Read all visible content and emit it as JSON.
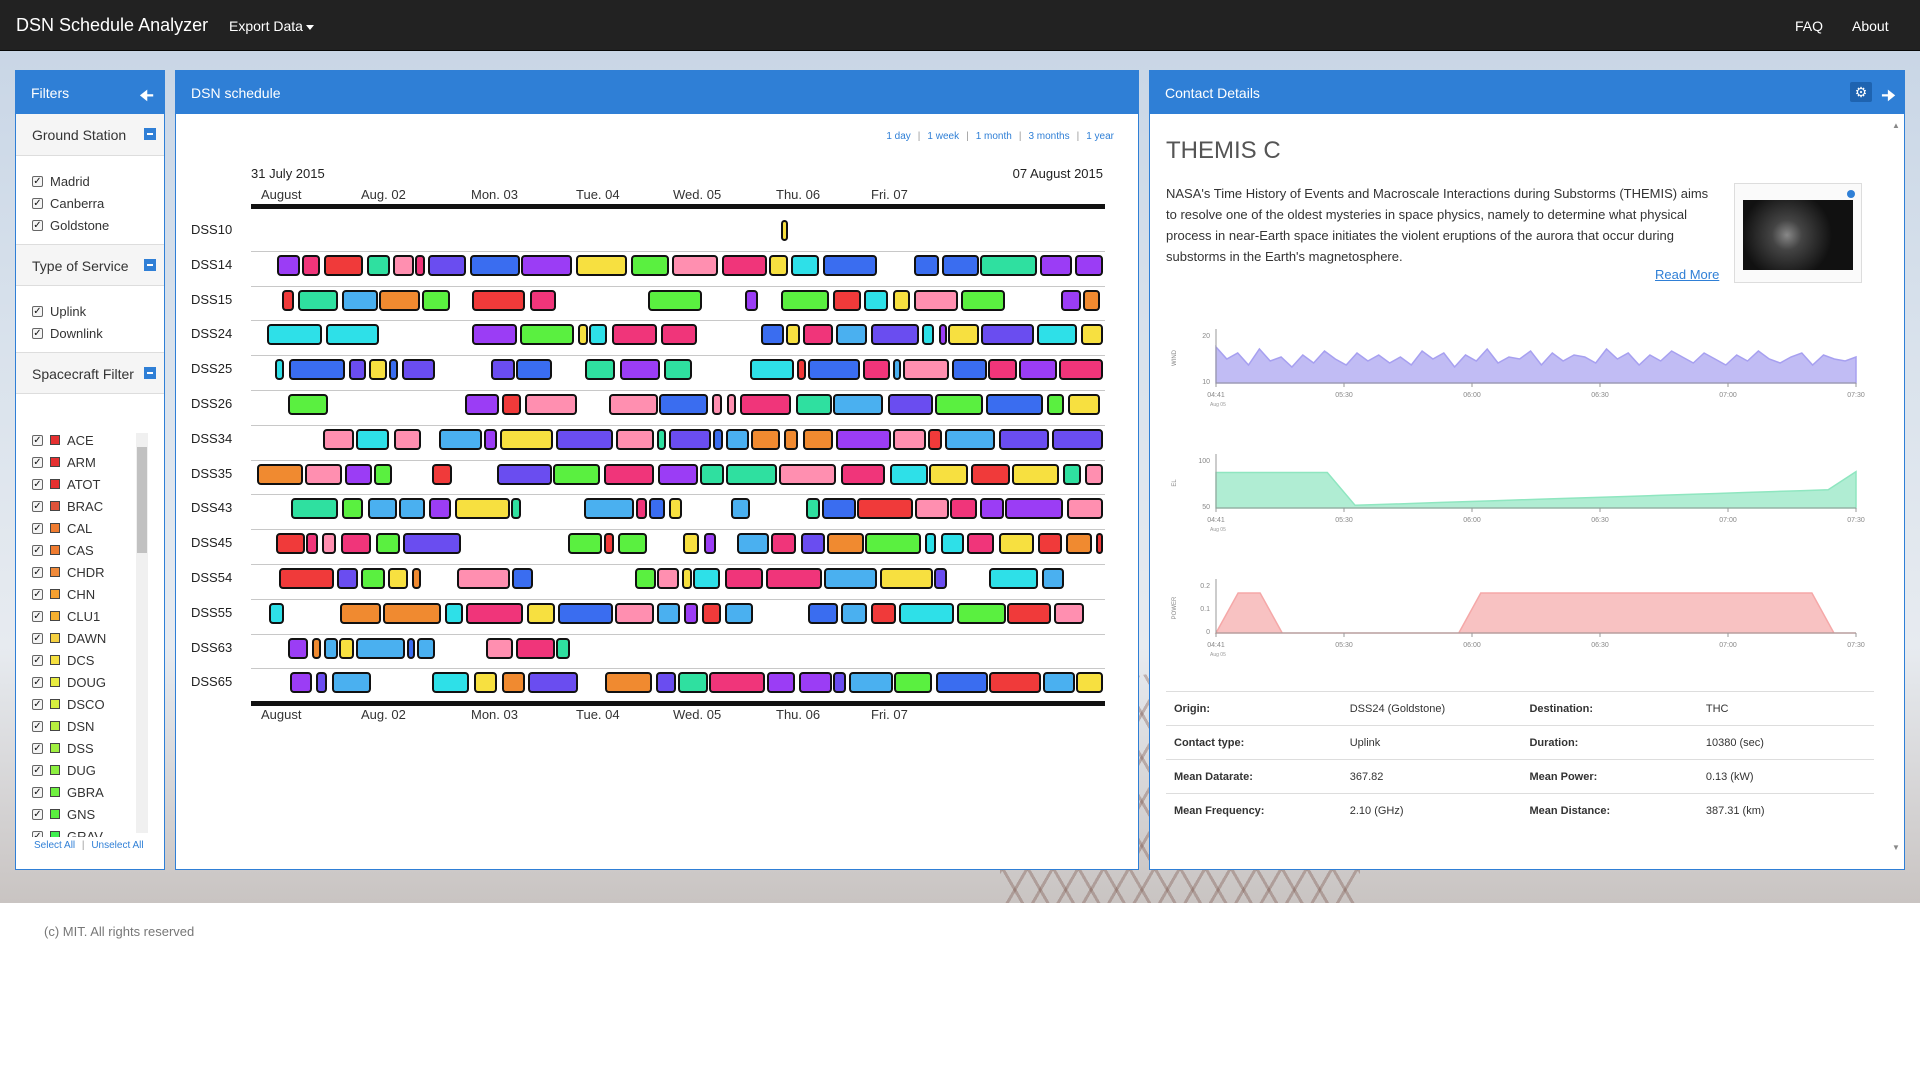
{
  "nav": {
    "brand": "DSN Schedule Analyzer",
    "export": "Export Data",
    "faq": "FAQ",
    "about": "About"
  },
  "filters": {
    "title": "Filters",
    "ground_station": {
      "title": "Ground Station",
      "items": [
        "Madrid",
        "Canberra",
        "Goldstone"
      ]
    },
    "service": {
      "title": "Type of Service",
      "items": [
        "Uplink",
        "Downlink"
      ]
    },
    "spacecraft": {
      "title": "Spacecraft Filter",
      "items": [
        {
          "name": "ACE",
          "color": "#e53030"
        },
        {
          "name": "ARM",
          "color": "#e53030"
        },
        {
          "name": "ATOT",
          "color": "#e53030"
        },
        {
          "name": "BRAC",
          "color": "#e0533a"
        },
        {
          "name": "CAL",
          "color": "#f07c30"
        },
        {
          "name": "CAS",
          "color": "#f07c30"
        },
        {
          "name": "CHDR",
          "color": "#f08a3a"
        },
        {
          "name": "CHN",
          "color": "#f5a030"
        },
        {
          "name": "CLU1",
          "color": "#f5b030"
        },
        {
          "name": "DAWN",
          "color": "#f5d040"
        },
        {
          "name": "DCS",
          "color": "#f5e040"
        },
        {
          "name": "DOUG",
          "color": "#e8ec40"
        },
        {
          "name": "DSCO",
          "color": "#d8f040"
        },
        {
          "name": "DSN",
          "color": "#b8f040"
        },
        {
          "name": "DSS",
          "color": "#a0f040"
        },
        {
          "name": "DUG",
          "color": "#8cf040"
        },
        {
          "name": "GBRA",
          "color": "#70f040"
        },
        {
          "name": "GNS",
          "color": "#5af040"
        },
        {
          "name": "GRAV",
          "color": "#40f050"
        }
      ],
      "select_all": "Select All",
      "unselect_all": "Unselect All"
    }
  },
  "schedule": {
    "title": "DSN schedule",
    "ranges": [
      "1 day",
      "1 week",
      "1 month",
      "3 months",
      "1 year"
    ],
    "date_start": "31 July 2015",
    "date_end": "07 August 2015",
    "ticks": [
      "August",
      "Aug. 02",
      "Mon. 03",
      "Tue. 04",
      "Wed. 05",
      "Thu. 06",
      "Fri. 07"
    ],
    "stations": [
      "DSS10",
      "DSS14",
      "DSS15",
      "DSS24",
      "DSS25",
      "DSS26",
      "DSS34",
      "DSS35",
      "DSS43",
      "DSS45",
      "DSS54",
      "DSS55",
      "DSS63",
      "DSS65"
    ],
    "palette": [
      "#3a6df0",
      "#9b3df5",
      "#2ee0e8",
      "#f0357a",
      "#f7e040",
      "#2fe0a0",
      "#f08a30",
      "#6a4df0",
      "#5af040",
      "#ff8fb0",
      "#f03a3a",
      "#4ab0f0"
    ]
  },
  "details": {
    "title": "Contact Details",
    "spacecraft_name": "THEMIS C",
    "description": "NASA's Time History of Events and Macroscale Interactions during Substorms (THEMIS) aims to resolve one of the oldest mysteries in space physics, namely to determine what physical process in near-Earth space initiates the violent eruptions of the aurora that occur during substorms in the Earth's magnetosphere.",
    "read_more": "Read More",
    "chart_data": [
      {
        "type": "area",
        "ylabel": "WIND",
        "y_ticks": [
          "20",
          "10"
        ],
        "ylim": [
          0,
          25
        ],
        "x_ticks": [
          "04:41",
          "05:30",
          "06:00",
          "06:30",
          "07:00",
          "07:30"
        ],
        "x_sub": "Aug 05",
        "series_color": "#a7a0f0",
        "values": [
          18,
          12,
          15,
          9,
          17,
          11,
          13,
          8,
          14,
          10,
          16,
          12,
          9,
          15,
          11,
          14,
          10,
          13,
          9,
          16,
          12,
          15,
          8,
          14,
          11,
          17,
          10,
          13,
          12,
          16,
          9,
          15,
          11,
          14,
          13,
          10,
          17,
          12,
          15,
          9,
          14,
          11,
          16,
          13,
          10,
          15,
          12,
          9,
          14,
          11,
          16,
          12,
          10,
          13,
          15,
          9,
          14,
          12,
          11,
          13
        ]
      },
      {
        "type": "area",
        "ylabel": "EL",
        "y_ticks": [
          "100",
          "50"
        ],
        "ylim": [
          0,
          110
        ],
        "x_ticks": [
          "04:41",
          "05:30",
          "06:00",
          "06:30",
          "07:00",
          "07:30"
        ],
        "x_sub": "Aug 05",
        "series_color": "#8fe6c0",
        "values": [
          78,
          78,
          78,
          78,
          78,
          6,
          8,
          10,
          12,
          14,
          16,
          18,
          20,
          22,
          24,
          26,
          28,
          30,
          32,
          34,
          36,
          38,
          40,
          80
        ]
      },
      {
        "type": "area",
        "ylabel": "POWER",
        "y_ticks": [
          "0.2",
          "0.1",
          "0"
        ],
        "ylim": [
          0,
          0.25
        ],
        "x_ticks": [
          "04:41",
          "05:30",
          "06:00",
          "06:30",
          "07:00",
          "07:30"
        ],
        "x_sub": "Aug 05",
        "series_color": "#f5a8a8",
        "values": [
          0,
          0.2,
          0.2,
          0,
          0,
          0,
          0,
          0,
          0,
          0,
          0,
          0,
          0.2,
          0.2,
          0.2,
          0.2,
          0.2,
          0.2,
          0.2,
          0.2,
          0.2,
          0.2,
          0.2,
          0.2,
          0.2,
          0.2,
          0.2,
          0.2,
          0,
          0
        ]
      }
    ],
    "info": [
      {
        "l1": "Origin:",
        "v1": "DSS24 (Goldstone)",
        "l2": "Destination:",
        "v2": "THC"
      },
      {
        "l1": "Contact type:",
        "v1": "Uplink",
        "l2": "Duration:",
        "v2": "10380 (sec)"
      },
      {
        "l1": "Mean Datarate:",
        "v1": "367.82",
        "l2": "Mean Power:",
        "v2": "0.13 (kW)"
      },
      {
        "l1": "Mean Frequency:",
        "v1": "2.10 (GHz)",
        "l2": "Mean Distance:",
        "v2": "387.31 (km)"
      }
    ]
  },
  "footer": "(c) MIT. All rights reserved"
}
